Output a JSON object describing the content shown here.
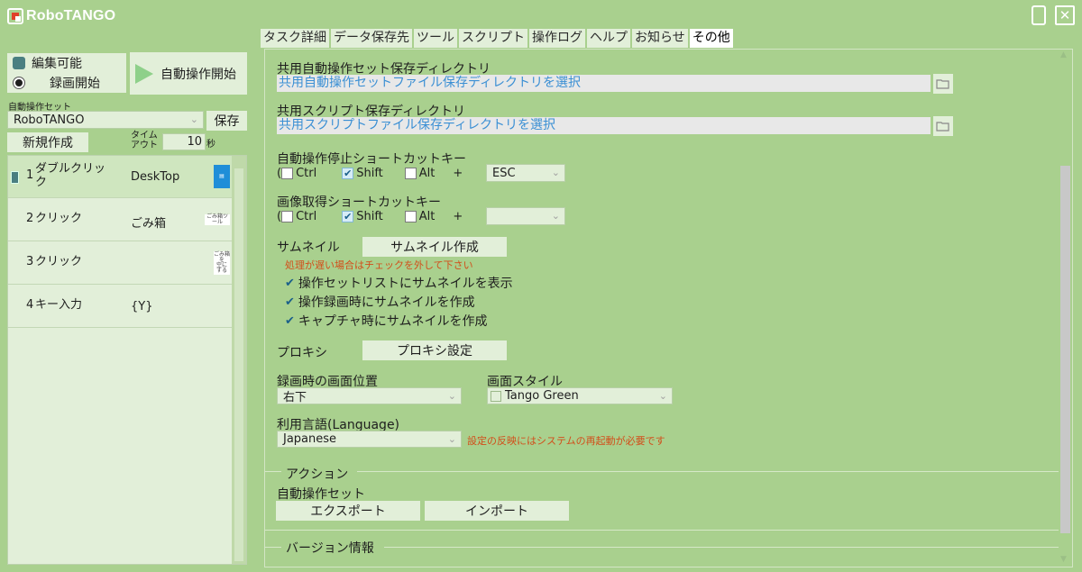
{
  "app": {
    "title": "RoboTANGO"
  },
  "left": {
    "editable_label": "編集可能",
    "record_label": "録画開始",
    "auto_run_label": "自動操作開始",
    "set_label": "自動操作セット",
    "set_value": "RoboTANGO",
    "save_label": "保存",
    "new_label": "新規作成",
    "timeout_label": "タイム\nアウト",
    "timeout_value": "10",
    "timeout_unit": "秒"
  },
  "tasks": [
    {
      "num": "1",
      "action": "ダブルクリック",
      "target": "DeskTop",
      "thumb": ""
    },
    {
      "num": "2",
      "action": "クリック",
      "target": "ごみ箱",
      "thumb": "ごみ箱ツール"
    },
    {
      "num": "3",
      "action": "クリック",
      "target": "",
      "thumb": "ごみ箱を\n空にする"
    },
    {
      "num": "4",
      "action": "キー入力",
      "target": "{Y}",
      "thumb": ""
    }
  ],
  "tabs": [
    "タスク詳細",
    "データ保存先",
    "ツール",
    "スクリプト",
    "操作ログ",
    "ヘルプ",
    "お知らせ",
    "その他"
  ],
  "active_tab": "その他",
  "settings": {
    "shared_set_dir_label": "共用自動操作セット保存ディレクトリ",
    "shared_set_dir_value": "共用自動操作セットファイル保存ディレクトリを選択",
    "shared_script_dir_label": "共用スクリプト保存ディレクトリ",
    "shared_script_dir_value": "共用スクリプトファイル保存ディレクトリを選択",
    "stop_shortcut_label": "自動操作停止ショートカットキー",
    "capture_shortcut_label": "画像取得ショートカットキー",
    "paren": "(",
    "ctrl": "Ctrl",
    "shift": "Shift",
    "alt": "Alt",
    "plus": "+",
    "stop_key": "ESC",
    "capture_key": "",
    "thumbnail_label": "サムネイル",
    "thumbnail_button": "サムネイル作成",
    "thumbnail_warning": "処理が遅い場合はチェックを外して下さい",
    "thumb_opt1": "操作セットリストにサムネイルを表示",
    "thumb_opt2": "操作録画時にサムネイルを作成",
    "thumb_opt3": "キャプチャ時にサムネイルを作成",
    "proxy_label": "プロキシ",
    "proxy_button": "プロキシ設定",
    "rec_position_label": "録画時の画面位置",
    "rec_position_value": "右下",
    "style_label": "画面スタイル",
    "style_value": "Tango Green",
    "language_label": "利用言語(Language)",
    "language_value": "Japanese",
    "language_note": "設定の反映にはシステムの再起動が必要です"
  },
  "action_group": {
    "title": "アクション",
    "set_label": "自動操作セット",
    "export_label": "エクスポート",
    "import_label": "インポート"
  },
  "version_group": {
    "title": "バージョン情報"
  },
  "colors": {
    "background": "#a9d08e",
    "control": "#e2efd9",
    "accent": "#4a7f81",
    "link": "#3a8fd4",
    "warning": "#d24e1a"
  }
}
